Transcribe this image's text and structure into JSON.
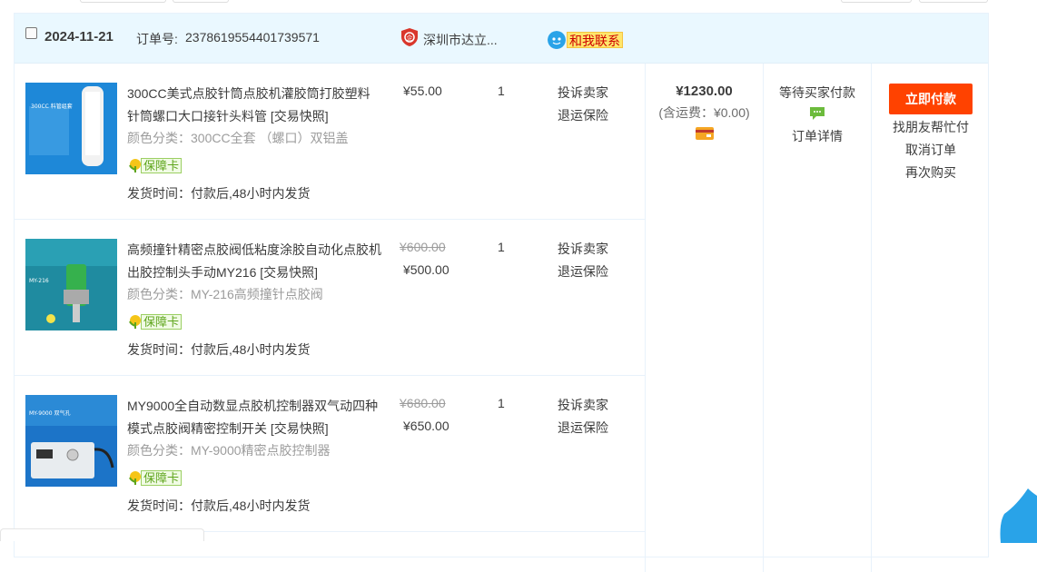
{
  "order": {
    "date": "2024-11-21",
    "order_no_label": "订单号:",
    "order_no": "2378619554401739571",
    "shop_name": "深圳市达立...",
    "chat_label": "和我联系",
    "total": "¥1230.00",
    "shipping_fee": "(含运费：¥0.00)",
    "status": "等待买家付款",
    "detail_link": "订单详情",
    "pay_button": "立即付款",
    "action_links": [
      "找朋友帮忙付",
      "取消订单",
      "再次购买"
    ]
  },
  "items": [
    {
      "title": "300CC美式点胶针筒点胶机灌胶筒打胶塑料针筒螺口大口接针头料管",
      "snapshot": "[交易快照]",
      "spec": "颜色分类：300CC全套 （螺口）双铝盖",
      "guard": "保障卡",
      "ship": "发货时间：付款后,48小时内发货",
      "price_old": "",
      "price": "¥55.00",
      "qty": "1",
      "service1": "投诉卖家",
      "service2": "退运保险",
      "thumb_label": "300CC 料管组套"
    },
    {
      "title": "高频撞针精密点胶阀低粘度涂胶自动化点胶机出胶控制头手动MY216",
      "snapshot": "[交易快照]",
      "spec": "颜色分类：MY-216高频撞针点胶阀",
      "guard": "保障卡",
      "ship": "发货时间：付款后,48小时内发货",
      "price_old": "¥600.00",
      "price": "¥500.00",
      "qty": "1",
      "service1": "投诉卖家",
      "service2": "退运保险",
      "thumb_label": "MY-216"
    },
    {
      "title": "MY9000全自动数显点胶机控制器双气动四种模式点胶阀精密控制开关",
      "snapshot": "[交易快照]",
      "spec": "颜色分类：MY-9000精密点胶控制器",
      "guard": "保障卡",
      "ship": "发货时间：付款后,48小时内发货",
      "price_old": "¥680.00",
      "price": "¥650.00",
      "qty": "1",
      "service1": "投诉卖家",
      "service2": "退运保险",
      "thumb_label": "MY-9000 双气孔"
    }
  ],
  "colors": {
    "header_bg": "#eaf8ff",
    "pay_button": "#ff4200",
    "border": "#e8f2fb"
  },
  "icons": [
    "checkbox-icon",
    "shop-shield-icon",
    "chat-bubble-icon",
    "guard-leaf-icon",
    "card-icon",
    "message-icon"
  ]
}
